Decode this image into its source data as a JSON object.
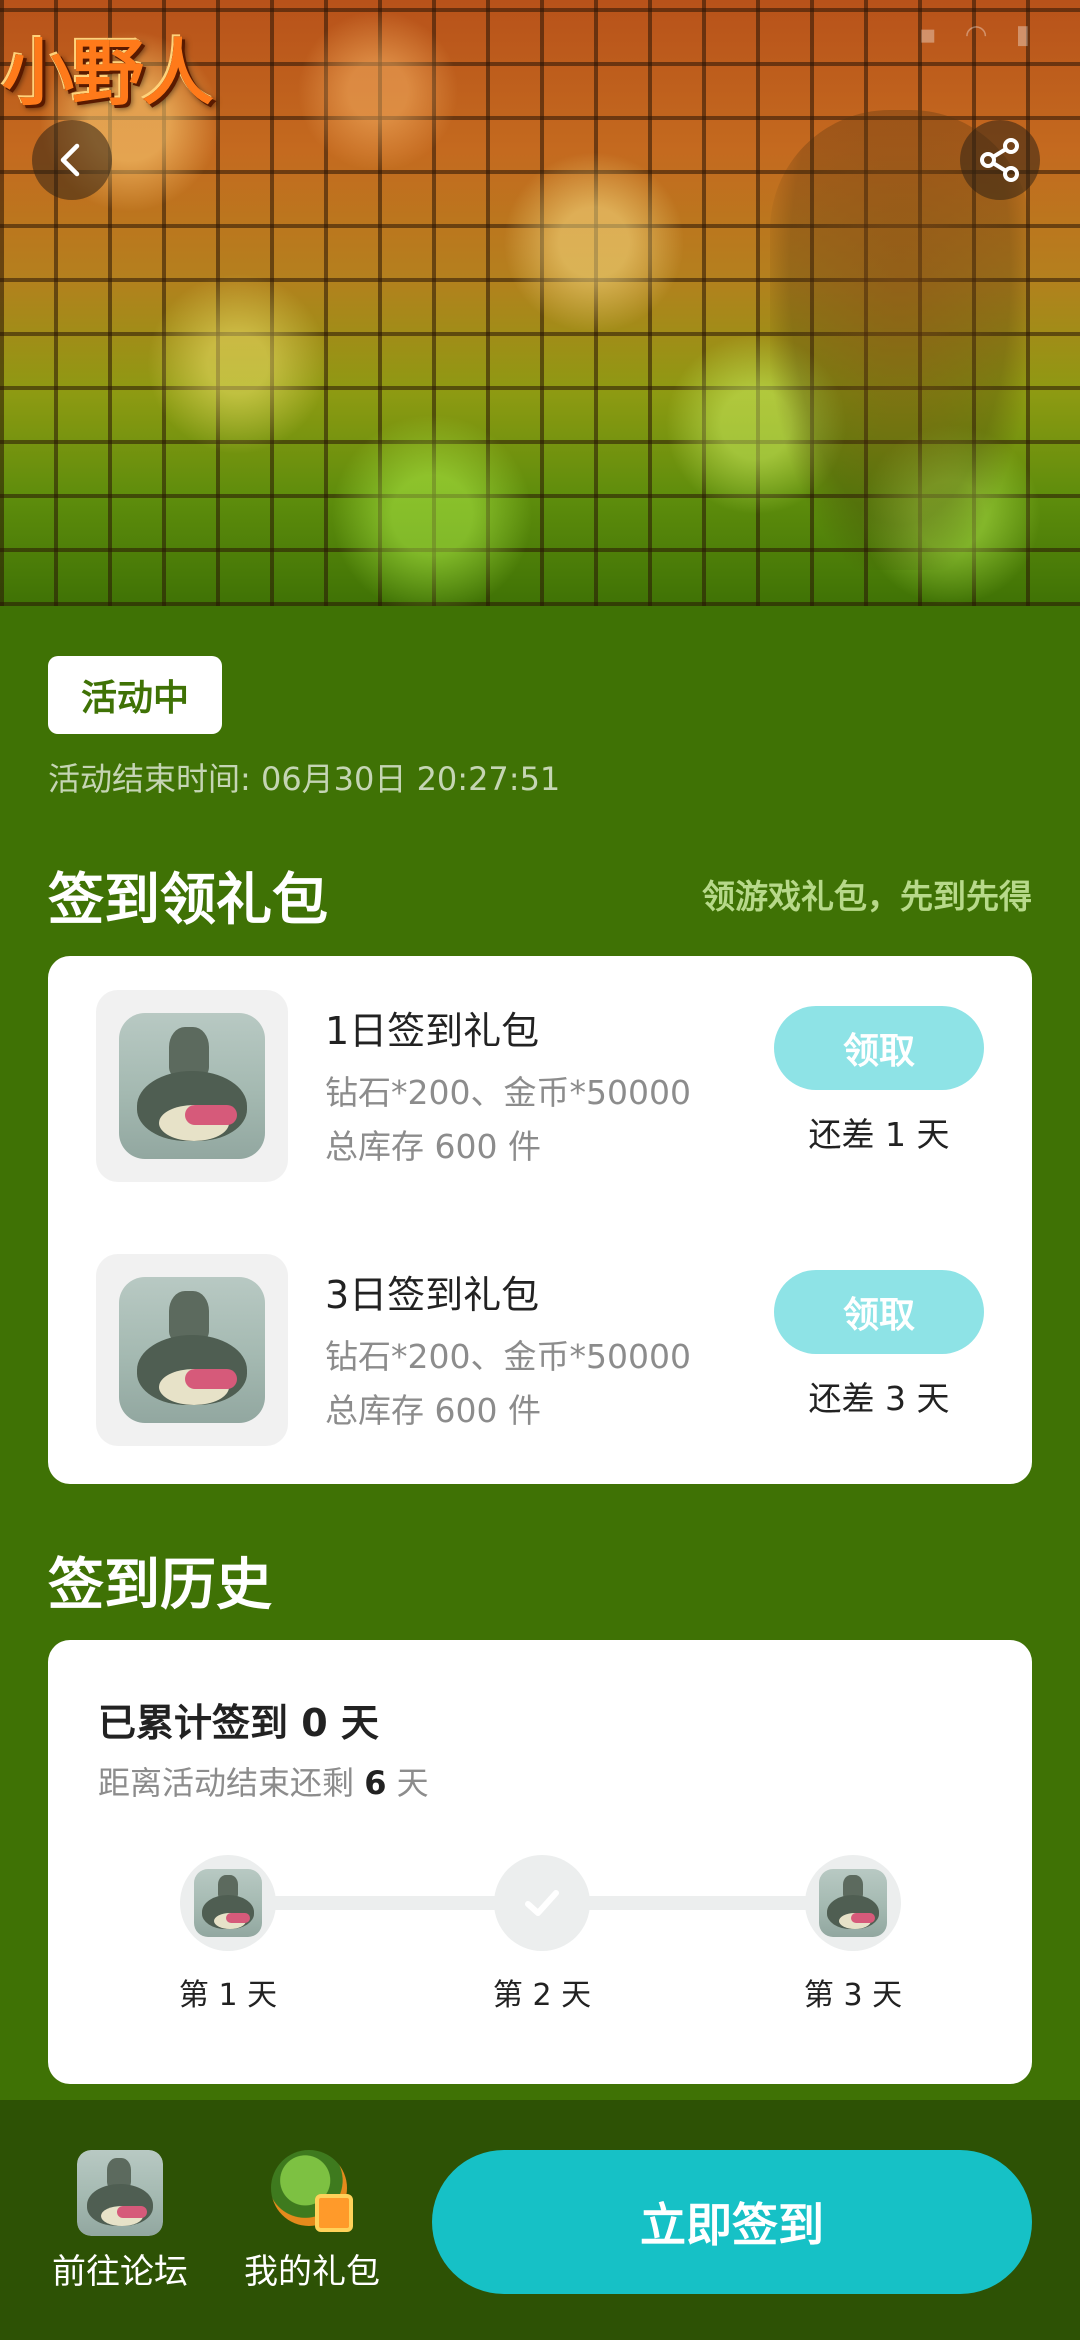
{
  "banner": {
    "game_logo": "小野人",
    "back_icon": "chevron-left-icon",
    "share_icon": "share-icon"
  },
  "activity": {
    "status": "活动中",
    "end_time": "活动结束时间: 06月30日 20:27:51"
  },
  "sign_section": {
    "title": "签到领礼包",
    "slogan": "领游戏礼包，先到先得"
  },
  "gifts": [
    {
      "name": "1日签到礼包",
      "description": "钻石*200、金币*50000",
      "stock": "总库存 600 件",
      "claim_label": "领取",
      "remaining": "还差 1 天"
    },
    {
      "name": "3日签到礼包",
      "description": "钻石*200、金币*50000",
      "stock": "总库存 600 件",
      "claim_label": "领取",
      "remaining": "还差 3 天"
    }
  ],
  "history": {
    "title": "签到历史",
    "total_prefix": "已累计签到 ",
    "total_days": "0",
    "total_suffix": " 天",
    "remain_prefix": "距离活动结束还剩 ",
    "remain_days": "6",
    "remain_suffix": " 天",
    "days": [
      {
        "label": "第 1 天",
        "icon": "toad-reward-icon"
      },
      {
        "label": "第 2 天",
        "icon": "check-icon"
      },
      {
        "label": "第 3 天",
        "icon": "toad-reward-icon"
      }
    ]
  },
  "bottom_bar": {
    "forum_label": "前往论坛",
    "my_gifts_label": "我的礼包",
    "checkin_label": "立即签到"
  },
  "colors": {
    "background": "#3f7205",
    "claim_button": "#8ee3e6",
    "checkin_button": "#16c1c6",
    "bottom_bar": "#2d5205"
  }
}
